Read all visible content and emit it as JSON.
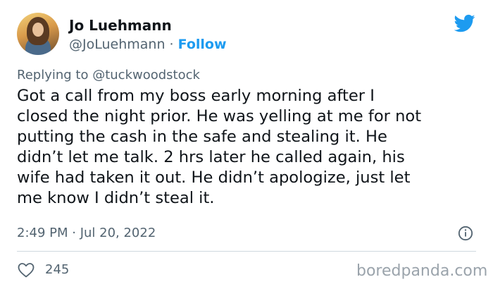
{
  "author": {
    "name": "Jo Luehmann",
    "handle": "@JoLuehmann",
    "separator": "·",
    "follow_label": "Follow"
  },
  "platform_icon": "twitter-bird-icon",
  "reply_context": {
    "prefix": "Replying to ",
    "mention": "@tuckwoodstock"
  },
  "tweet": {
    "text": "Got a call from my boss early morning after I\nclosed the night prior. He was yelling at me for not\nputting the cash in the safe and stealing it. He\ndidn’t let me talk. 2 hrs later he called again, his\nwife had taken it out. He didn’t apologize, just let\nme know I didn’t steal it.",
    "timestamp": "2:49 PM · Jul 20, 2022"
  },
  "engagement": {
    "likes": "245"
  },
  "watermark": "boredpanda.com",
  "colors": {
    "accent": "#1d9bf0",
    "text": "#0f1419",
    "muted": "#536471",
    "divider": "#cfd9de"
  }
}
